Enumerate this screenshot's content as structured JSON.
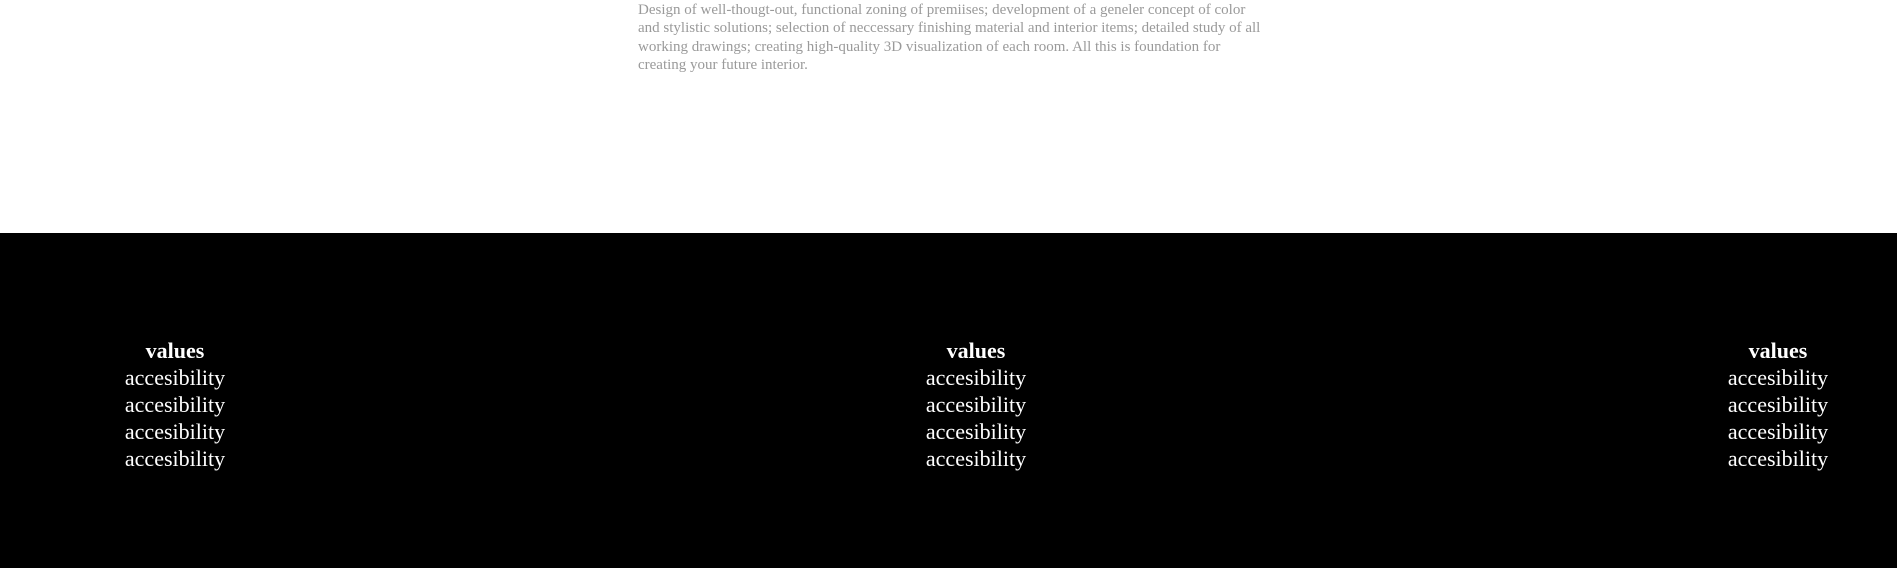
{
  "intro": {
    "description": "Design of well-thougt-out, functional zoning of premiises; development of a geneler concept of color and stylistic solutions; selection of neccessary finishing material and interior items; detailed study of all working drawings; creating high-quality 3D visualization of each room. All this is foundation for creating your future interior."
  },
  "footer": {
    "columns": [
      {
        "heading": "values",
        "links": [
          "accesibility",
          "accesibility",
          "accesibility",
          "accesibility"
        ]
      },
      {
        "heading": "values",
        "links": [
          "accesibility",
          "accesibility",
          "accesibility",
          "accesibility"
        ]
      },
      {
        "heading": "values",
        "links": [
          "accesibility",
          "accesibility",
          "accesibility",
          "accesibility"
        ]
      }
    ]
  },
  "colors": {
    "footer_background": "#000000",
    "footer_text": "#ffffff",
    "description_text": "#9a9a9a",
    "page_background": "#ffffff"
  }
}
